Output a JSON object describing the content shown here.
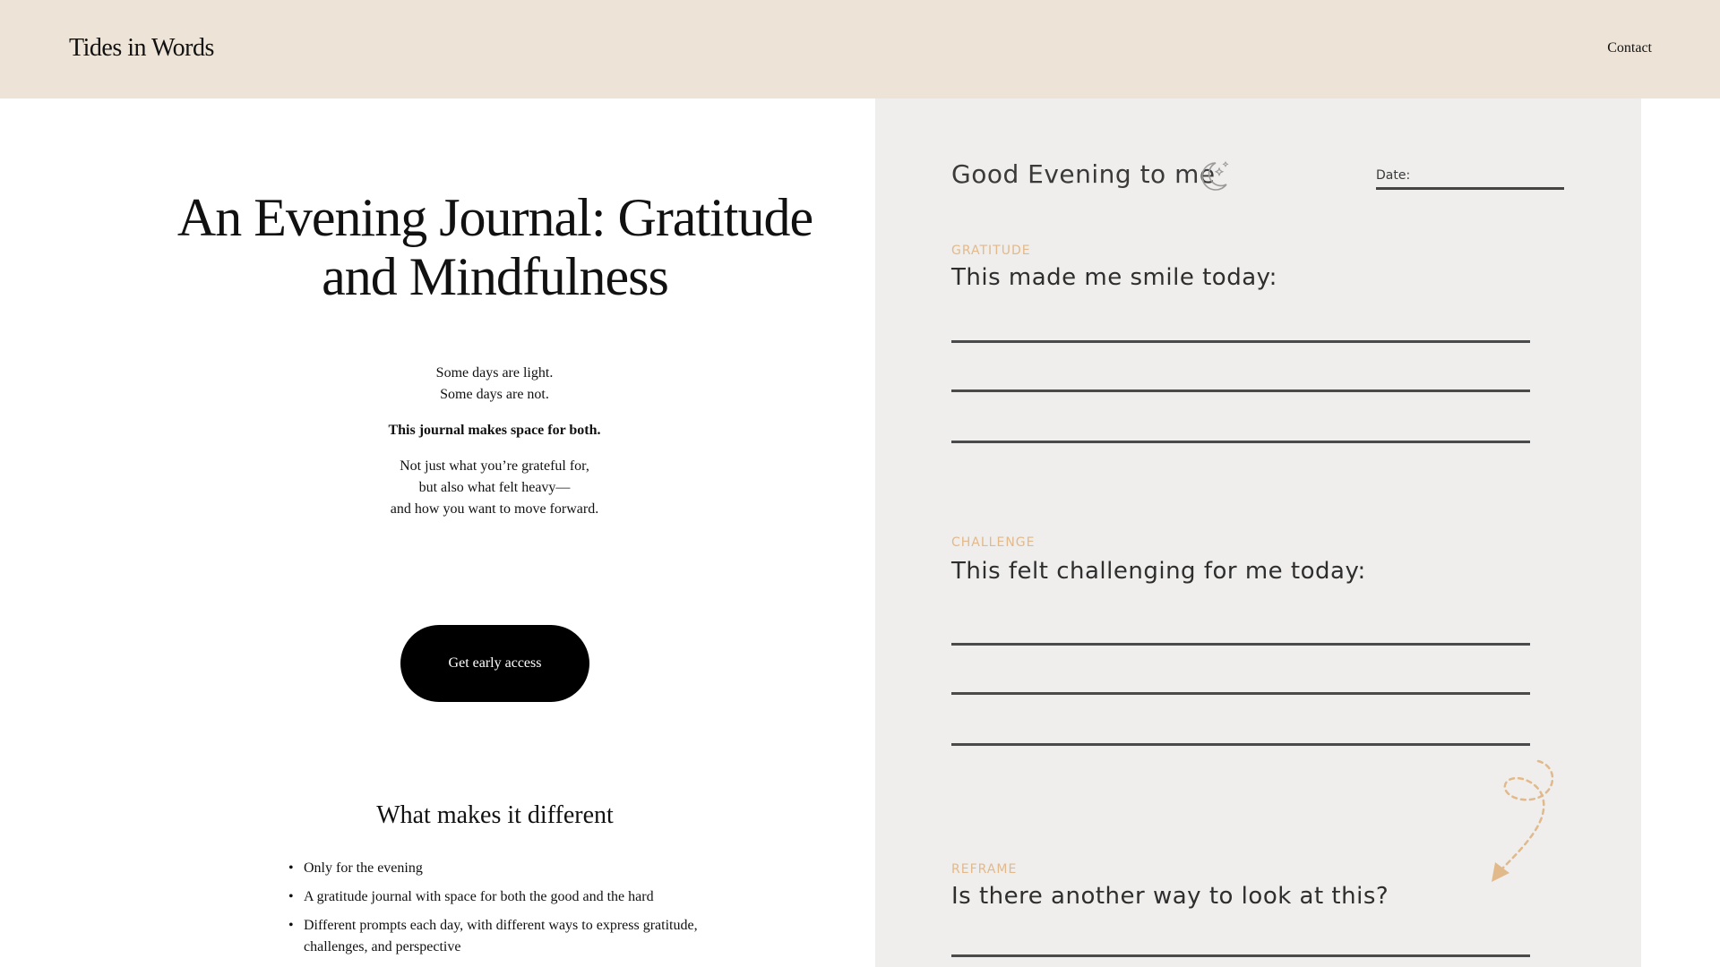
{
  "header": {
    "brand": "Tides in Words",
    "nav": {
      "contact": "Contact"
    }
  },
  "hero": {
    "title": "An Evening Journal: Gratitude and Mindfulness",
    "intro": {
      "line1": "Some days are light.",
      "line2": "Some days are not.",
      "bold": "This journal makes space for both.",
      "line3": "Not just what you’re grateful for,",
      "line4": "but also what felt heavy—",
      "line5": "and how you want to move forward."
    },
    "cta_label": "Get early access"
  },
  "features": {
    "heading": "What makes it different",
    "items": [
      "Only for the evening",
      "A gratitude journal with space for both the good and the hard",
      "Different prompts each day, with different ways to express gratitude, challenges, and perspective"
    ]
  },
  "journal_page": {
    "greeting": "Good Evening to me",
    "date_label": "Date:",
    "sections": [
      {
        "tag": "GRATITUDE",
        "prompt": "This made me smile today:"
      },
      {
        "tag": "CHALLENGE",
        "prompt": "This felt challenging for me today:"
      },
      {
        "tag": "REFRAME",
        "prompt": "Is there another way to look at this?"
      }
    ],
    "icons": {
      "moon": "moon-stars-icon",
      "doodle": "dashed-arrow-doodle"
    }
  },
  "colors": {
    "header_bg": "#ede4d7",
    "paper_bg": "#efeeec",
    "cta_bg": "#000000",
    "tag_accent": "#e2b98a"
  }
}
